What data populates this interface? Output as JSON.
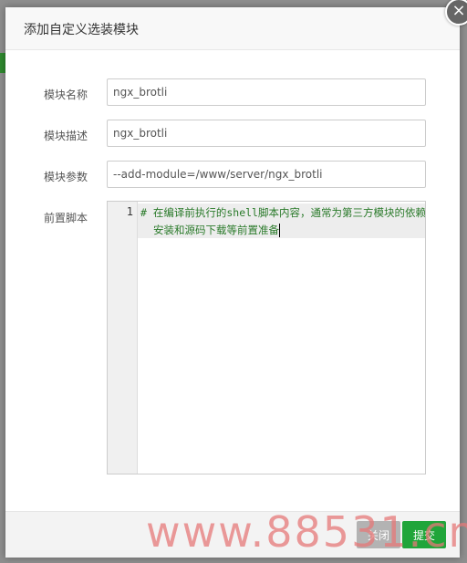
{
  "dialog": {
    "title": "添加自定义选装模块",
    "close_icon": "×"
  },
  "form": {
    "name_label": "模块名称",
    "name_value": "ngx_brotli",
    "desc_label": "模块描述",
    "desc_value": "ngx_brotli",
    "params_label": "模块参数",
    "params_value": "--add-module=/www/server/ngx_brotli",
    "script_label": "前置脚本"
  },
  "editor": {
    "line_number": "1",
    "code": "# 在编译前执行的shell脚本内容，通常为第三方模块的依赖安装和源码下载等前置准备"
  },
  "footer": {
    "close_label": "关闭",
    "submit_label": "提交"
  },
  "watermark": "www.88531.cn",
  "colors": {
    "submit": "#20a53a",
    "code_text": "#2a7a2a"
  }
}
